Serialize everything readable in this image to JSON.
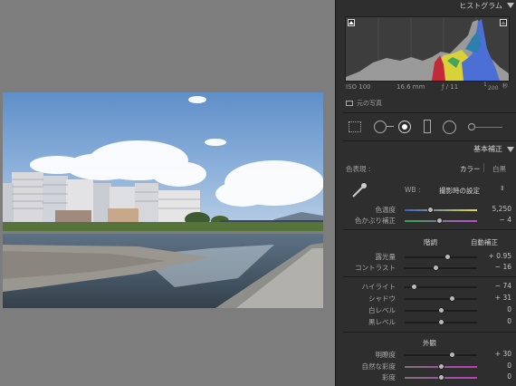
{
  "histogram": {
    "header": "ヒストグラム",
    "iso": "ISO 100",
    "focal": "16.6 mm",
    "aperture": "ƒ / 11",
    "shutter_num": "1",
    "shutter_den": "200",
    "shutter_suffix": "秒",
    "original_photo": "元の写真"
  },
  "basic": {
    "header": "基本補正",
    "treatment_label": "色表現 :",
    "color": "カラー",
    "bw": "白黒",
    "wb_label": "WB :",
    "wb_value": "撮影時の設定",
    "tone_label": "階調",
    "auto": "自動補正",
    "presence_label": "外観"
  },
  "sliders": [
    {
      "key": "temp",
      "label": "色温度",
      "value": "5,250",
      "pos": 0.35
    },
    {
      "key": "tint",
      "label": "色かぶり補正",
      "value": "− 4",
      "pos": 0.48
    },
    {
      "key": "exposure",
      "label": "露光量",
      "value": "+ 0.95",
      "pos": 0.59
    },
    {
      "key": "contrast",
      "label": "コントラスト",
      "value": "− 16",
      "pos": 0.42
    },
    {
      "key": "highlights",
      "label": "ハイライト",
      "value": "− 74",
      "pos": 0.13
    },
    {
      "key": "shadows",
      "label": "シャドウ",
      "value": "+ 31",
      "pos": 0.65
    },
    {
      "key": "whites",
      "label": "白レベル",
      "value": "0",
      "pos": 0.5
    },
    {
      "key": "blacks",
      "label": "黒レベル",
      "value": "0",
      "pos": 0.5
    },
    {
      "key": "clarity",
      "label": "明瞭度",
      "value": "+ 30",
      "pos": 0.65
    },
    {
      "key": "vibrance",
      "label": "自然な彩度",
      "value": "0",
      "pos": 0.5
    },
    {
      "key": "saturation",
      "label": "彩度",
      "value": "0",
      "pos": 0.5
    }
  ],
  "colors": {
    "panel": "#2e2e2e",
    "canvas": "#7d7d7d",
    "active_tool": "#ffffff"
  },
  "icons": [
    "crop-icon",
    "spot-removal-icon",
    "redeye-icon",
    "graduated-filter-icon",
    "radial-filter-icon",
    "adjustment-brush-icon",
    "eyedropper-icon"
  ]
}
